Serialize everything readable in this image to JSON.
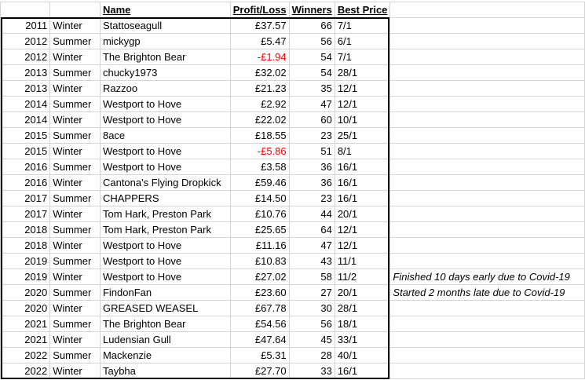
{
  "header": {
    "year": "",
    "season": "",
    "name": "Name",
    "profit_loss": "Profit/Loss",
    "winners": "Winners",
    "best_price": "Best Price"
  },
  "rows": [
    {
      "year": "2011",
      "season": "Winter",
      "name": "Stattoseagull",
      "profit": "£37.57",
      "winners": "66",
      "price": "7/1",
      "note": ""
    },
    {
      "year": "2012",
      "season": "Summer",
      "name": "mickygp",
      "profit": "£5.47",
      "winners": "56",
      "price": "6/1",
      "note": ""
    },
    {
      "year": "2012",
      "season": "Winter",
      "name": "The Brighton Bear",
      "profit": "-£1.94",
      "winners": "54",
      "price": "7/1",
      "note": ""
    },
    {
      "year": "2013",
      "season": "Summer",
      "name": "chucky1973",
      "profit": "£32.02",
      "winners": "54",
      "price": "28/1",
      "note": ""
    },
    {
      "year": "2013",
      "season": "Winter",
      "name": "Razzoo",
      "profit": "£21.23",
      "winners": "35",
      "price": "12/1",
      "note": ""
    },
    {
      "year": "2014",
      "season": "Summer",
      "name": "Westport to Hove",
      "profit": "£2.92",
      "winners": "47",
      "price": "12/1",
      "note": ""
    },
    {
      "year": "2014",
      "season": "Winter",
      "name": "Westport to Hove",
      "profit": "£22.02",
      "winners": "60",
      "price": "10/1",
      "note": ""
    },
    {
      "year": "2015",
      "season": "Summer",
      "name": "8ace",
      "profit": "£18.55",
      "winners": "23",
      "price": "25/1",
      "note": ""
    },
    {
      "year": "2015",
      "season": "Winter",
      "name": "Westport to Hove",
      "profit": "-£5.86",
      "winners": "51",
      "price": "8/1",
      "note": ""
    },
    {
      "year": "2016",
      "season": "Summer",
      "name": "Westport to Hove",
      "profit": "£3.58",
      "winners": "36",
      "price": "16/1",
      "note": ""
    },
    {
      "year": "2016",
      "season": "Winter",
      "name": "Cantona's Flying Dropkick",
      "profit": "£59.46",
      "winners": "36",
      "price": "16/1",
      "note": ""
    },
    {
      "year": "2017",
      "season": "Summer",
      "name": "CHAPPERS",
      "profit": "£14.50",
      "winners": "23",
      "price": "16/1",
      "note": ""
    },
    {
      "year": "2017",
      "season": "Winter",
      "name": "Tom Hark, Preston Park",
      "profit": "£10.76",
      "winners": "44",
      "price": "20/1",
      "note": ""
    },
    {
      "year": "2018",
      "season": "Summer",
      "name": "Tom Hark, Preston Park",
      "profit": "£25.65",
      "winners": "64",
      "price": "12/1",
      "note": ""
    },
    {
      "year": "2018",
      "season": "Winter",
      "name": "Westport to Hove",
      "profit": "£11.16",
      "winners": "47",
      "price": "12/1",
      "note": ""
    },
    {
      "year": "2019",
      "season": "Summer",
      "name": "Westport to Hove",
      "profit": "£10.83",
      "winners": "43",
      "price": "11/1",
      "note": ""
    },
    {
      "year": "2019",
      "season": "Winter",
      "name": "Westport to Hove",
      "profit": "£27.02",
      "winners": "58",
      "price": "11/2",
      "note": "Finished 10 days early due to Covid-19"
    },
    {
      "year": "2020",
      "season": "Summer",
      "name": "FindonFan",
      "profit": "£23.60",
      "winners": "27",
      "price": "20/1",
      "note": "Started 2 months late due to Covid-19"
    },
    {
      "year": "2020",
      "season": "Winter",
      "name": "GREASED WEASEL",
      "profit": "£67.78",
      "winners": "30",
      "price": "28/1",
      "note": ""
    },
    {
      "year": "2021",
      "season": "Summer",
      "name": "The Brighton Bear",
      "profit": "£54.56",
      "winners": "56",
      "price": "18/1",
      "note": ""
    },
    {
      "year": "2021",
      "season": "Winter",
      "name": "Ludensian Gull",
      "profit": "£47.64",
      "winners": "45",
      "price": "33/1",
      "note": ""
    },
    {
      "year": "2022",
      "season": "Summer",
      "name": "Mackenzie",
      "profit": "£5.31",
      "winners": "28",
      "price": "40/1",
      "note": ""
    },
    {
      "year": "2022",
      "season": "Winter",
      "name": "Taybha",
      "profit": "£27.70",
      "winners": "33",
      "price": "16/1",
      "note": ""
    }
  ],
  "colors": {
    "negative": "#ff0000",
    "gridline": "#d4d4d4",
    "outline": "#000000"
  }
}
